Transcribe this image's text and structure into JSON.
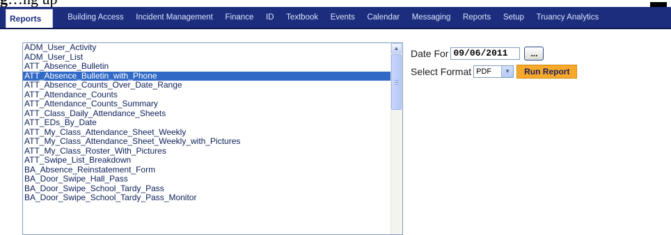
{
  "header_fragment": {
    "bold": "g",
    "text": "…ng up"
  },
  "nav": {
    "active_tab": "Reports",
    "items": [
      "Building Access",
      "Incident Management",
      "Finance",
      "ID",
      "Textbook",
      "Events",
      "Calendar",
      "Messaging",
      "Reports",
      "Setup",
      "Truancy Analytics"
    ]
  },
  "report_list": {
    "selected_index": 3,
    "items": [
      "ADM_User_Activity",
      "ADM_User_List",
      "ATT_Absence_Bulletin",
      "ATT_Absence_Bulletin_with_Phone",
      "ATT_Absence_Counts_Over_Date_Range",
      "ATT_Attendance_Counts",
      "ATT_Attendance_Counts_Summary",
      "ATT_Class_Daily_Attendance_Sheets",
      "ATT_EDs_By_Date",
      "ATT_My_Class_Attendance_Sheet_Weekly",
      "ATT_My_Class_Attendance_Sheet_Weekly_with_Pictures",
      "ATT_My_Class_Roster_With_Pictures",
      "ATT_Swipe_List_Breakdown",
      "BA_Absence_Reinstatement_Form",
      "BA_Door_Swipe_Hall_Pass",
      "BA_Door_Swipe_School_Tardy_Pass",
      "BA_Door_Swipe_School_Tardy_Pass_Monitor"
    ]
  },
  "form": {
    "date_label": "Date For",
    "date_value": "09/06/2011",
    "date_button": "...",
    "format_label": "Select Format",
    "format_value": "PDF",
    "run_button": "Run Report"
  },
  "icons": {
    "scroll_up": "chevron-up-icon",
    "dropdown": "chevron-down-icon"
  },
  "colors": {
    "nav_bg": "#1b2d7c",
    "selected_row": "#3169c6",
    "run_button": "#f7a92a"
  }
}
